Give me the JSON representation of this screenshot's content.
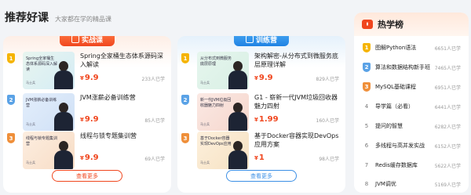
{
  "header": {
    "title": "推荐好课",
    "subtitle": "大家都在学的精品课"
  },
  "practice": {
    "label": "实战课",
    "more": "查看更多",
    "courses": [
      {
        "rank": "1",
        "thumb": "Spring全家桶生态体系源码深入解读",
        "teacher": "马士兵",
        "title": "Spring全家桶生态体系源码深入解读",
        "price_tag": "¥",
        "price": "9.9",
        "learners": "233人已学"
      },
      {
        "rank": "2",
        "thumb": "JVM涨薪必备训练营",
        "teacher": "马士兵",
        "title": "JVM涨薪必备训练营",
        "price_tag": "¥",
        "price": "9.9",
        "learners": "85人已学"
      },
      {
        "rank": "3",
        "thumb": "线程与锁专题集训营",
        "teacher": "马士兵",
        "title": "线程与锁专题集训营",
        "price_tag": "¥",
        "price": "9.9",
        "learners": "69人已学"
      }
    ]
  },
  "training": {
    "label": "训练营",
    "more": "查看更多",
    "courses": [
      {
        "rank": "1",
        "thumb": "从分布式到微服务底层原理",
        "teacher": "马士兵",
        "title": "架构解密-从分布式到微服务底层原理详解",
        "price_tag": "¥",
        "price": "9.9",
        "learners": "829人已学"
      },
      {
        "rank": "2",
        "thumb": "新一代JVM垃圾回收器魅力四射",
        "teacher": "马士兵",
        "title": "G1 - 崭新一代JVM垃圾回收器魅力四射",
        "price_tag": "¥",
        "price": "1.99",
        "learners": "160人已学"
      },
      {
        "rank": "3",
        "thumb": "基于Docker容器实现DevOps应用",
        "teacher": "马士兵",
        "title": "基于Docker容器实现DevOps应用方案",
        "price_tag": "¥",
        "price": "1",
        "learners": "98人已学"
      }
    ]
  },
  "hot": {
    "title": "热学榜",
    "items": [
      {
        "rank": "1",
        "label": "图解Python语法",
        "count": "6651人已学"
      },
      {
        "rank": "2",
        "label": "算法和数据结构新手班",
        "count": "7465人已学"
      },
      {
        "rank": "3",
        "label": "MySQL基础课程",
        "count": "6951人已学"
      },
      {
        "rank": "4",
        "label": "导学篇（必看）",
        "count": "6441人已学"
      },
      {
        "rank": "5",
        "label": "提问的智慧",
        "count": "6282人已学"
      },
      {
        "rank": "6",
        "label": "多线程与高并发实战",
        "count": "6152人已学"
      },
      {
        "rank": "7",
        "label": "Redis缓存数据库",
        "count": "5622人已学"
      },
      {
        "rank": "8",
        "label": "JVM调优",
        "count": "5169人已学"
      }
    ]
  },
  "colors": {
    "accent_red": "#f0461e",
    "accent_blue": "#1f82e3",
    "gold": "#f5b400"
  },
  "icons": {
    "hot_logo": "hot-rank-logo-icon",
    "ribbon": "book-icon"
  }
}
